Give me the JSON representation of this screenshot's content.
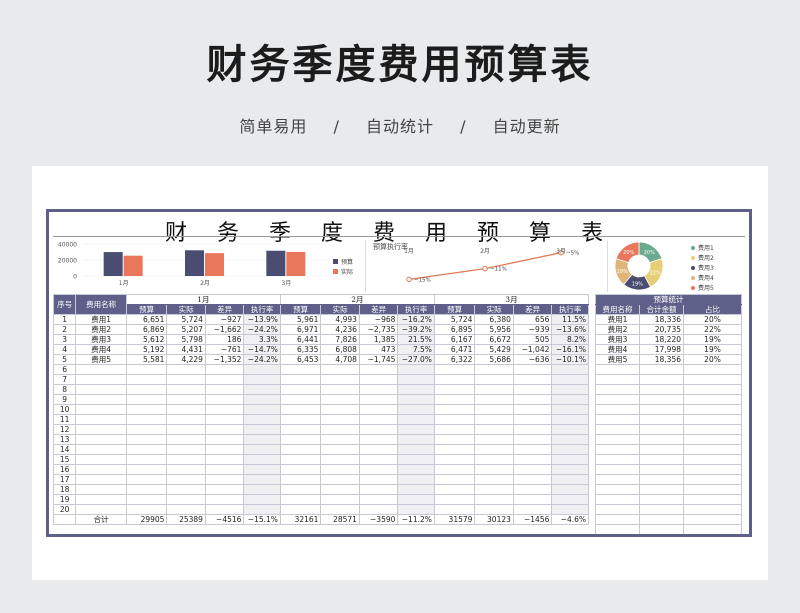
{
  "hero": {
    "title": "财务季度费用预算表",
    "tags": [
      "简单易用",
      "/",
      "自动统计",
      "/",
      "自动更新"
    ]
  },
  "sheet": {
    "title": "财务季度费用预算表",
    "headers": {
      "seq": "序号",
      "name": "费用名称",
      "months": [
        "1月",
        "2月",
        "3月"
      ],
      "sub": [
        "预算",
        "实际",
        "差异",
        "执行率"
      ],
      "total_label": "合计"
    },
    "rows": [
      {
        "seq": "1",
        "name": "费用1",
        "m": [
          [
            "6,651",
            "5,724",
            "−927",
            "−13.9%"
          ],
          [
            "5,961",
            "4,993",
            "−968",
            "−16.2%"
          ],
          [
            "5,724",
            "6,380",
            "656",
            "11.5%"
          ]
        ]
      },
      {
        "seq": "2",
        "name": "费用2",
        "m": [
          [
            "6,869",
            "5,207",
            "−1,662",
            "−24.2%"
          ],
          [
            "6,971",
            "4,236",
            "−2,735",
            "−39.2%"
          ],
          [
            "6,895",
            "5,956",
            "−939",
            "−13.6%"
          ]
        ]
      },
      {
        "seq": "3",
        "name": "费用3",
        "m": [
          [
            "5,612",
            "5,798",
            "186",
            "3.3%"
          ],
          [
            "6,441",
            "7,826",
            "1,385",
            "21.5%"
          ],
          [
            "6,167",
            "6,672",
            "505",
            "8.2%"
          ]
        ]
      },
      {
        "seq": "4",
        "name": "费用4",
        "m": [
          [
            "5,192",
            "4,431",
            "−761",
            "−14.7%"
          ],
          [
            "6,335",
            "6,808",
            "473",
            "7.5%"
          ],
          [
            "6,471",
            "5,429",
            "−1,042",
            "−16.1%"
          ]
        ]
      },
      {
        "seq": "5",
        "name": "费用5",
        "m": [
          [
            "5,581",
            "4,229",
            "−1,352",
            "−24.2%"
          ],
          [
            "6,453",
            "4,708",
            "−1,745",
            "−27.0%"
          ],
          [
            "6,322",
            "5,686",
            "−636",
            "−10.1%"
          ]
        ]
      }
    ],
    "empty_seqs": [
      "6",
      "7",
      "8",
      "9",
      "10",
      "11",
      "12",
      "13",
      "14",
      "15",
      "16",
      "17",
      "18",
      "19",
      "20"
    ],
    "totals": [
      [
        "29905",
        "25389",
        "−4516",
        "−15.1%"
      ],
      [
        "32161",
        "28571",
        "−3590",
        "−11.2%"
      ],
      [
        "31579",
        "30123",
        "−1456",
        "−4.6%"
      ]
    ]
  },
  "stats": {
    "title": "预算统计",
    "headers": [
      "费用名称",
      "合计金额",
      "占比"
    ],
    "rows": [
      [
        "费用1",
        "18,336",
        "20%"
      ],
      [
        "费用2",
        "20,735",
        "22%"
      ],
      [
        "费用3",
        "18,220",
        "19%"
      ],
      [
        "费用4",
        "17,998",
        "19%"
      ],
      [
        "费用5",
        "18,356",
        "20%"
      ]
    ]
  },
  "chart_data": [
    {
      "type": "bar",
      "categories": [
        "1月",
        "2月",
        "3月"
      ],
      "series": [
        {
          "name": "预算",
          "values": [
            29905,
            32161,
            31579
          ]
        },
        {
          "name": "实际",
          "values": [
            25389,
            28571,
            30123
          ]
        }
      ],
      "yticks": [
        "40000",
        "20000",
        "0"
      ],
      "ylim": [
        0,
        40000
      ],
      "legend": "right",
      "colors": [
        "#4a4c72",
        "#e8775c"
      ]
    },
    {
      "type": "line",
      "title": "预算执行率",
      "categories": [
        "1月",
        "2月",
        "3月"
      ],
      "values": [
        -15,
        -11,
        -5
      ],
      "labels": [
        "−15%",
        "−11%",
        "−5%"
      ],
      "color": "#e07a55"
    },
    {
      "type": "pie",
      "categories": [
        "费用1",
        "费用2",
        "费用3",
        "费用4",
        "费用5"
      ],
      "values": [
        20,
        22,
        19,
        19,
        20
      ],
      "labels": [
        "20%",
        "22%",
        "19%",
        "19%",
        "20%"
      ],
      "colors": [
        "#6aab8e",
        "#e8cf77",
        "#4a4c72",
        "#e0b57a",
        "#e8775c"
      ],
      "legend": "right"
    }
  ]
}
